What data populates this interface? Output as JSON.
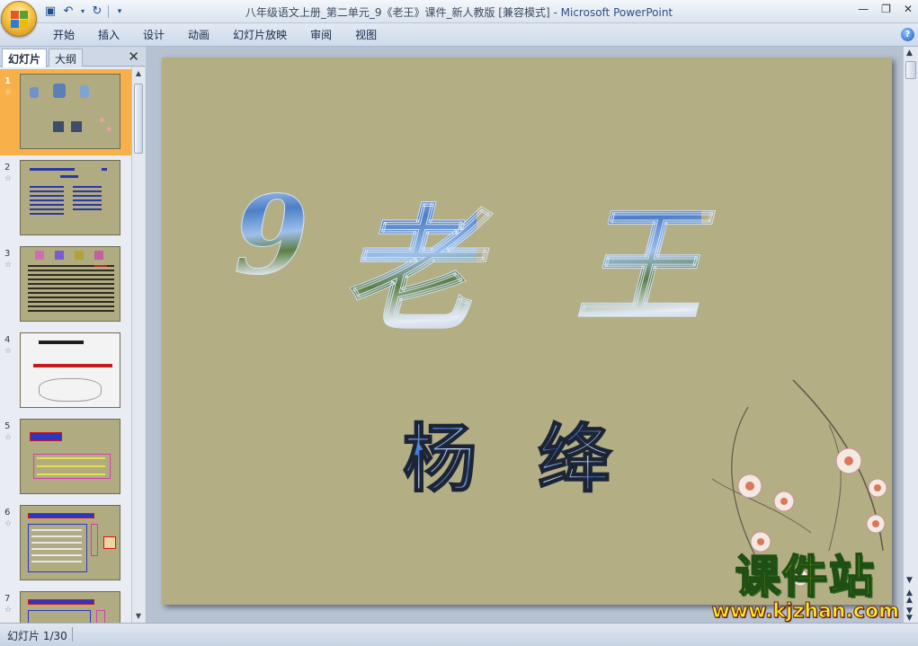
{
  "window": {
    "title": "八年级语文上册_第二单元_9《老王》课件_新人教版 [兼容模式]",
    "app_name": "Microsoft PowerPoint",
    "title_separator": " - "
  },
  "quick_access": [
    "save-icon",
    "undo-icon",
    "redo-icon",
    "customize-icon"
  ],
  "ribbon": {
    "tabs": [
      "开始",
      "插入",
      "设计",
      "动画",
      "幻灯片放映",
      "审阅",
      "视图"
    ]
  },
  "left_panel": {
    "tab_slides": "幻灯片",
    "tab_outline": "大纲",
    "thumbnails": [
      {
        "number": "1",
        "active": true
      },
      {
        "number": "2",
        "active": false
      },
      {
        "number": "3",
        "active": false
      },
      {
        "number": "4",
        "active": false
      },
      {
        "number": "5",
        "active": false
      },
      {
        "number": "6",
        "active": false
      },
      {
        "number": "7",
        "active": false
      }
    ]
  },
  "slide": {
    "title_number": "9",
    "title_char_1": "老",
    "title_char_2": "王",
    "author_char_1": "杨",
    "author_char_2": "绛",
    "background_color": "#b4ae85",
    "watermark_cn": "课件站",
    "watermark_url": "www.kjzhan.com"
  },
  "status_bar": {
    "slide_indicator": "幻灯片 1/30"
  }
}
